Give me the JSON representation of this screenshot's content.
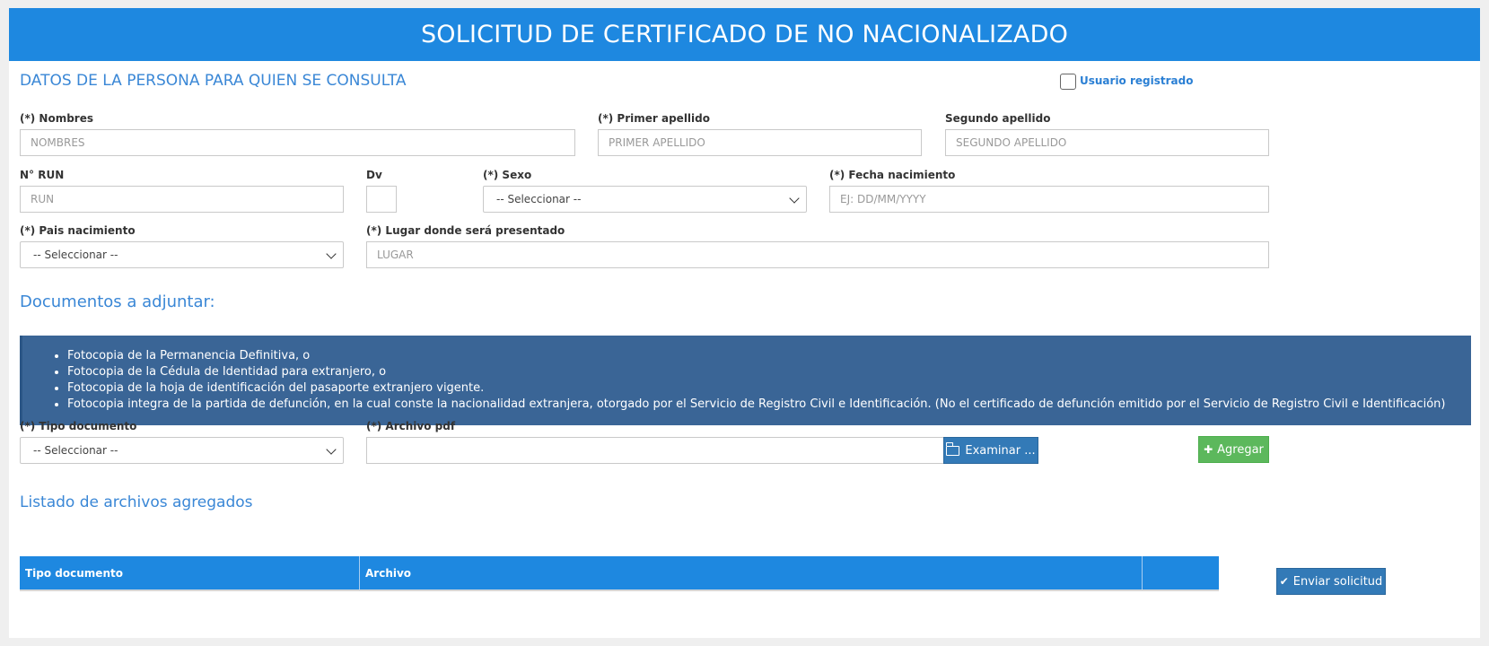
{
  "header": {
    "title": "SOLICITUD DE CERTIFICADO DE NO NACIONALIZADO"
  },
  "persona": {
    "section_title": "DATOS DE LA PERSONA PARA QUIEN SE CONSULTA",
    "registered_user_label": "Usuario registrado",
    "registered_user_checked": false,
    "fields": {
      "nombres": {
        "label": "(*) Nombres",
        "placeholder": "NOMBRES",
        "value": ""
      },
      "primer_apellido": {
        "label": "(*) Primer apellido",
        "placeholder": "PRIMER APELLIDO",
        "value": ""
      },
      "segundo_apellido": {
        "label": "Segundo apellido",
        "placeholder": "SEGUNDO APELLIDO",
        "value": ""
      },
      "run": {
        "label": "N° RUN",
        "placeholder": "RUN",
        "value": ""
      },
      "dv": {
        "label": "Dv",
        "placeholder": "",
        "value": ""
      },
      "sexo": {
        "label": "(*) Sexo",
        "selected": "-- Seleccionar --"
      },
      "fecha_nacimiento": {
        "label": "(*) Fecha nacimiento",
        "placeholder": "EJ: DD/MM/YYYY",
        "value": ""
      },
      "pais_nacimiento": {
        "label": "(*) Pais nacimiento",
        "selected": "-- Seleccionar --"
      },
      "lugar": {
        "label": "(*) Lugar donde será presentado",
        "placeholder": "LUGAR",
        "value": ""
      }
    }
  },
  "documentos": {
    "section_title": "Documentos a adjuntar:",
    "items": [
      "Fotocopia de la Permanencia Definitiva, o",
      "Fotocopia de la Cédula de Identidad para extranjero, o",
      "Fotocopia de la hoja de identificación del pasaporte extranjero vigente.",
      "Fotocopia integra de la partida de defunción, en la cual conste la nacionalidad extranjera, otorgado por el Servicio de Registro Civil e Identificación. (No el certificado de defunción emitido por el Servicio de Registro Civil e Identificación)"
    ],
    "tipo_documento": {
      "label": "(*) Tipo documento",
      "selected": "-- Seleccionar --"
    },
    "archivo_pdf": {
      "label": "(*) Archivo pdf",
      "value": ""
    },
    "browse_label": "Examinar ...",
    "add_label": "Agregar"
  },
  "listado": {
    "section_title": "Listado de archivos agregados",
    "columns": [
      "Tipo documento",
      "Archivo"
    ],
    "rows": []
  },
  "submit_label": "Enviar solicitud",
  "colors": {
    "header": "#1e88e0",
    "accent_text": "#3a87d6",
    "docs_box": "#3a6596",
    "button_primary": "#337ab7",
    "button_success": "#5cb85c"
  },
  "icons": {
    "browse": "folder-open-icon",
    "add": "plus-icon",
    "submit": "check-icon",
    "select": "chevron-down-icon"
  }
}
